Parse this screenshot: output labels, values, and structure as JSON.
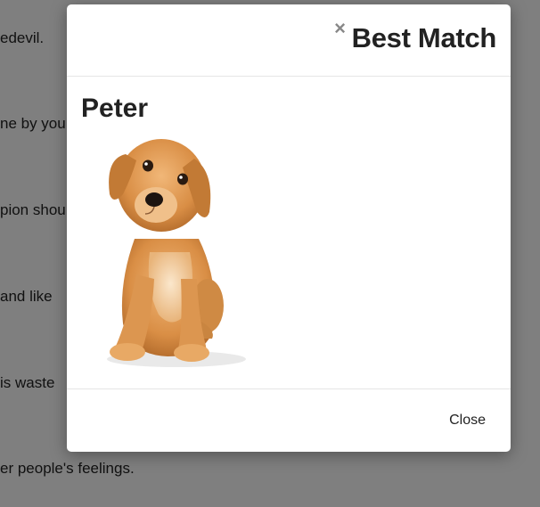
{
  "background": {
    "lines": [
      "edevil.",
      "ne by you",
      "pion shou",
      " and like",
      "is waste",
      "er people's feelings."
    ]
  },
  "modal": {
    "title": "Best Match",
    "close_icon": "×",
    "pet_name": "Peter",
    "pet_image_icon": "puppy-photo",
    "footer_close_label": "Close"
  },
  "colors": {
    "backdrop": "#7f7f7f",
    "text": "#222222",
    "close_icon": "#888888"
  }
}
